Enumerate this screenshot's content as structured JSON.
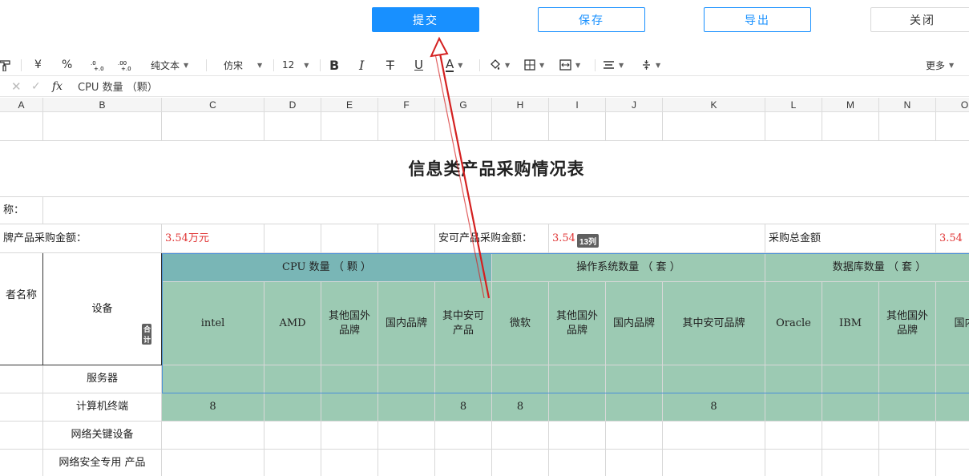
{
  "actions": {
    "submit": "提交",
    "save": "保存",
    "export": "导出",
    "close": "关闭"
  },
  "toolbar": {
    "currency": "¥",
    "percent": "%",
    "dec_add": ".0₀",
    "dec_sub": ".00",
    "format": "纯文本",
    "font": "仿宋",
    "size": "12",
    "bold": "B",
    "italic": "I",
    "strike": "T",
    "underline": "U",
    "font_color": "A",
    "more": "更多"
  },
  "formula": {
    "fx": "fx",
    "value": "CPU 数量 （颗）"
  },
  "columns": [
    "A",
    "B",
    "C",
    "D",
    "E",
    "F",
    "G",
    "H",
    "I",
    "J",
    "K",
    "L",
    "M",
    "N",
    "O"
  ],
  "sheet": {
    "title": "信息类产品采购情况表",
    "name_label": "称：",
    "brand_amount_label": "牌产品采购金额：",
    "brand_amount_value": "3.54万元",
    "anke_amount_label": "安可产品采购金额：",
    "anke_amount_value": "3.54",
    "total_label": "采购总金额",
    "total_value": "3.54",
    "vendor_header": "者名称",
    "device_header": "设备",
    "cpu_header": "CPU 数量 （ 颗 ）",
    "os_header": "操作系统数量 （ 套 ）",
    "db_header": "数据库数量 （ 套 ）",
    "sub": [
      "intel",
      "AMD",
      "其他国外品牌",
      "国内品牌",
      "其中安可产品",
      "微软",
      "其他国外品牌",
      "国内品牌",
      "其中安可品牌",
      "Oracle",
      "IBM",
      "其他国外品牌",
      "国内"
    ],
    "rows": [
      {
        "device": "服务器",
        "values": [
          "",
          "",
          "",
          "",
          "",
          "",
          "",
          "",
          "",
          "",
          "",
          "",
          ""
        ]
      },
      {
        "device": "计算机终端",
        "values": [
          "8",
          "",
          "",
          "",
          "8",
          "8",
          "",
          "",
          "8",
          "",
          "",
          "",
          ""
        ]
      },
      {
        "device": "网络关键设备",
        "values": [
          "",
          "",
          "",
          "",
          "",
          "",
          "",
          "",
          "",
          "",
          "",
          "",
          ""
        ]
      },
      {
        "device": "网络安全专用 产品",
        "values": [
          "",
          "",
          "",
          "",
          "",
          "",
          "",
          "",
          "",
          "",
          "",
          "",
          ""
        ]
      },
      {
        "device": "外接设备",
        "values": [
          "",
          "",
          "",
          "",
          "",
          "",
          "",
          "",
          "",
          "",
          "",
          "",
          ""
        ]
      }
    ]
  },
  "overlays": {
    "col_badge": "13列",
    "side_badge": "合计"
  },
  "colors": {
    "primary": "#1890ff",
    "header_teal": "#79b6b6",
    "cell_green": "#9ccab3",
    "amount_red": "#e03434",
    "arrow_red": "#d42020"
  }
}
